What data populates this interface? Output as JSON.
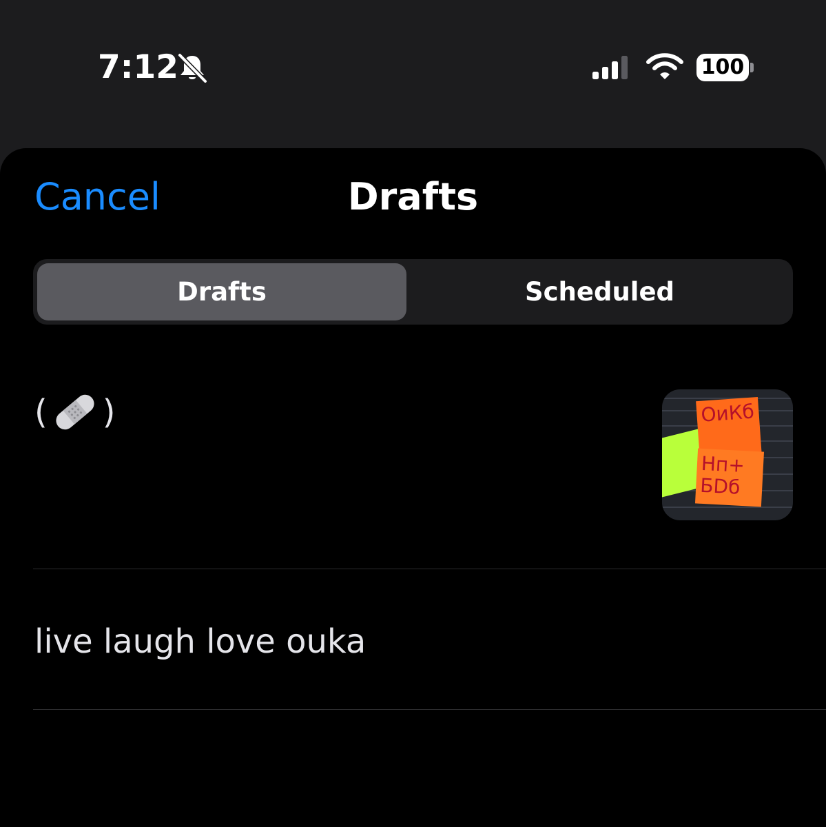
{
  "status_bar": {
    "time": "7:12",
    "battery_level": "100",
    "icons": [
      "bell-slash-icon",
      "cellular-signal-icon",
      "wifi-icon",
      "battery-icon"
    ]
  },
  "sheet": {
    "cancel_label": "Cancel",
    "title": "Drafts",
    "accent_color": "#1a8cff",
    "tabs": [
      {
        "label": "Drafts",
        "selected": true
      },
      {
        "label": "Scheduled",
        "selected": false
      }
    ],
    "drafts": [
      {
        "text_before": "(",
        "emoji_icon": "adhesive-bandage-icon",
        "text_after": ")",
        "has_thumbnail": true,
        "thumbnail_note_1": "ОиКб",
        "thumbnail_note_2": "Нп+ БDб"
      },
      {
        "text": "live laugh love ouka",
        "has_thumbnail": false
      }
    ]
  }
}
